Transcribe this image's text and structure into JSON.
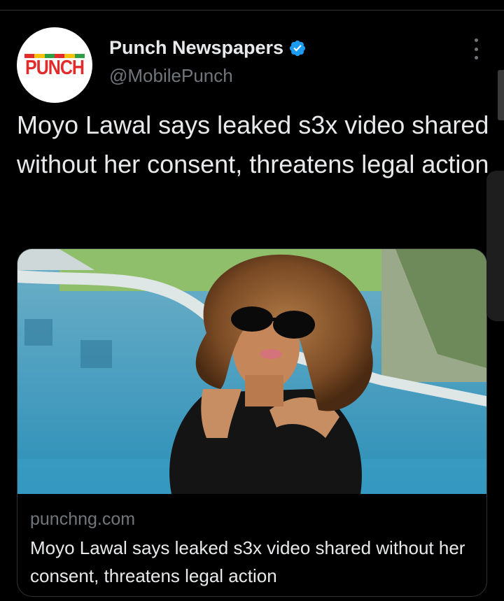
{
  "author": {
    "display_name": "Punch Newspapers",
    "handle": "@MobilePunch",
    "verified": true,
    "avatar_logo_text": "PUNCH",
    "avatar_stripe_colors": [
      "#e22b2a",
      "#f4c20d",
      "#2e9d44",
      "#e22b2a",
      "#f4c20d",
      "#2e9d44"
    ]
  },
  "tweet": {
    "text": "Moyo Lawal says leaked s3x video shared without her consent, threatens legal action"
  },
  "link_card": {
    "domain": "punchng.com",
    "title": "Moyo Lawal says leaked s3x video shared without her consent, threatens legal action",
    "image_icon": "photo-of-woman-with-curly-hair-and-sunglasses-by-pool"
  },
  "colors": {
    "background": "#000000",
    "text_primary": "#e7e9ea",
    "text_secondary": "#71767b",
    "verified_blue": "#1d9bf0",
    "border": "#2f3336"
  },
  "icons": {
    "more": "more-options-icon",
    "verified": "verified-badge-icon"
  }
}
